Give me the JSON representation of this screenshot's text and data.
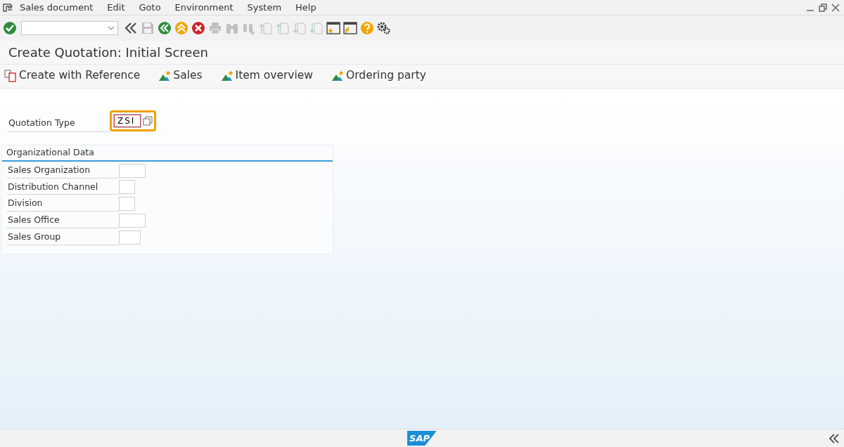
{
  "menu_bar": [
    {
      "label": "Sales document"
    },
    {
      "label": "Edit"
    },
    {
      "label": "Goto"
    },
    {
      "label": "Environment"
    },
    {
      "label": "System"
    },
    {
      "label": "Help"
    }
  ],
  "toolbar": [
    {
      "kind": "enter",
      "disabled": false
    },
    {
      "kind": "command"
    },
    {
      "kind": "collapse",
      "disabled": false
    },
    {
      "kind": "save",
      "disabled": true
    },
    {
      "kind": "back",
      "disabled": false
    },
    {
      "kind": "exit",
      "disabled": false
    },
    {
      "kind": "cancel",
      "disabled": false
    },
    {
      "kind": "print",
      "disabled": true
    },
    {
      "kind": "find",
      "disabled": true
    },
    {
      "kind": "find-next",
      "disabled": true
    },
    {
      "kind": "first",
      "disabled": true
    },
    {
      "kind": "prev",
      "disabled": true
    },
    {
      "kind": "next",
      "disabled": true
    },
    {
      "kind": "last",
      "disabled": true
    },
    {
      "kind": "new-session",
      "disabled": false
    },
    {
      "kind": "shortcut",
      "disabled": false
    },
    {
      "kind": "help",
      "disabled": false
    },
    {
      "kind": "settings",
      "disabled": false
    }
  ],
  "title": "Create Quotation: Initial Screen",
  "app_toolbar": [
    {
      "kind": "copy",
      "label": "Create with Reference"
    },
    {
      "kind": "partner",
      "label": "Sales"
    },
    {
      "kind": "partner",
      "label": "Item overview"
    },
    {
      "kind": "partner",
      "label": "Ordering party"
    }
  ],
  "quotation_type": {
    "label": "Quotation Type",
    "value": "ZSI",
    "highlighted": true
  },
  "organizational_data": {
    "title": "Organizational Data",
    "fields": [
      {
        "label": "Sales Organization",
        "kind": "wide"
      },
      {
        "label": "Distribution Channel",
        "kind": "narrow"
      },
      {
        "label": "Division",
        "kind": "narrow"
      },
      {
        "label": "Sales Office",
        "kind": "wide"
      },
      {
        "label": "Sales Group",
        "kind": "medium"
      }
    ]
  },
  "status_bar": {
    "logo": "SAP"
  }
}
